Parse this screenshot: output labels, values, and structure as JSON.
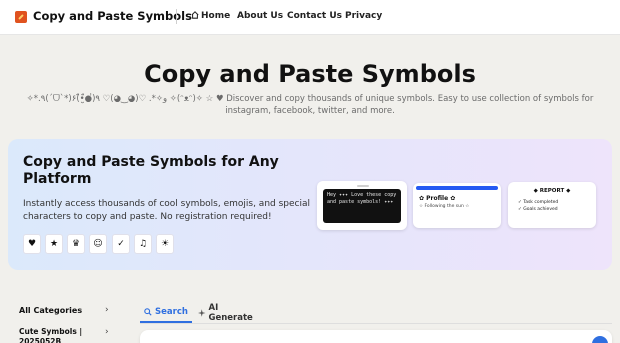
{
  "header": {
    "site_title": "Copy and Paste Symbols",
    "nav": [
      "Home",
      "About Us",
      "Contact Us",
      "Privacy"
    ]
  },
  "hero": {
    "title": "Copy and Paste Symbols",
    "subtitle": "✧*.٩(ˊᗜˋ*)و✧*. ♡(◕‿◕)♡ ٩(̾●̮̮̃̾•̃̾)۶ ✧(ᵔᴥᵔ)✧ ☆ ♥ Discover and copy thousands of unique symbols. Easy to use collection of symbols for instagram, facebook, twitter, and more."
  },
  "banner": {
    "title": "Copy and Paste Symbols for Any Platform",
    "description": "Instantly access thousands of cool symbols, emojis, and special characters to copy and paste. No registration required!",
    "symbols": [
      "♥",
      "★",
      "♛",
      "☺",
      "✓",
      "♫",
      "☀"
    ],
    "card_terminal": "Hey ✦✦✦ Love these copy and paste symbols! ✦✦✦",
    "card_profile_title": "✿ Profile ✿",
    "card_profile_sub": "☆ Following the sun ☆",
    "card_report_title": "◆ REPORT ◆",
    "card_report_lines": [
      "✓ Task completed",
      "✓ Goals achieved"
    ]
  },
  "sidebar": {
    "all_categories": "All Categories",
    "item1": "Cute Symbols | 2025052B"
  },
  "tabs": {
    "search": "Search",
    "ai": "AI Generate"
  },
  "colors": {
    "accent": "#2f6fe0",
    "logo": "#e0531f"
  }
}
